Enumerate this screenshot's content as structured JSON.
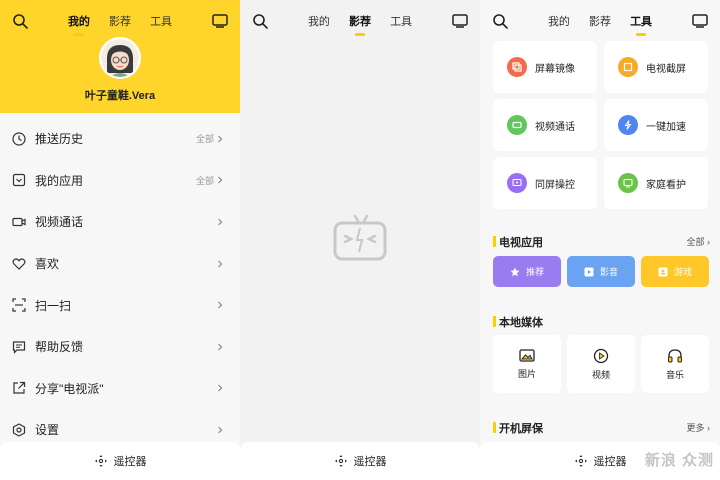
{
  "tabs": [
    "我的",
    "影荐",
    "工具"
  ],
  "panels_active_tab": [
    "我的",
    "影荐",
    "工具"
  ],
  "user": {
    "name": "叶子童鞋.Vera"
  },
  "menu": [
    {
      "label": "推送历史",
      "extra": "全部",
      "icon": "clock-icon"
    },
    {
      "label": "我的应用",
      "extra": "全部",
      "icon": "apps-icon"
    },
    {
      "label": "视频通话",
      "extra": "",
      "icon": "video-icon"
    },
    {
      "label": "喜欢",
      "extra": "",
      "icon": "heart-icon"
    },
    {
      "label": "扫一扫",
      "extra": "",
      "icon": "scan-icon"
    },
    {
      "label": "帮助反馈",
      "extra": "",
      "icon": "feedback-icon"
    },
    {
      "label": "分享\"电视派\"",
      "extra": "",
      "icon": "share-icon"
    },
    {
      "label": "设置",
      "extra": "",
      "icon": "settings-icon"
    }
  ],
  "remote_label": "遥控器",
  "tools": [
    {
      "label": "屏幕镜像",
      "color": "#f26b4c"
    },
    {
      "label": "电视截屏",
      "color": "#f7a928"
    },
    {
      "label": "视频通话",
      "color": "#61c75a"
    },
    {
      "label": "一键加速",
      "color": "#4f86f2"
    },
    {
      "label": "同屏操控",
      "color": "#9a6ef0"
    },
    {
      "label": "家庭看护",
      "color": "#6cc24a"
    }
  ],
  "tv_apps": {
    "title": "电视应用",
    "more": "全部",
    "items": [
      {
        "label": "推荐",
        "color": "#9b7cf0"
      },
      {
        "label": "影音",
        "color": "#6aa3f2"
      },
      {
        "label": "游戏",
        "color": "#ffc72a"
      }
    ]
  },
  "local_media": {
    "title": "本地媒体",
    "items": [
      {
        "label": "图片"
      },
      {
        "label": "视频"
      },
      {
        "label": "音乐"
      }
    ]
  },
  "screensaver": {
    "title": "开机屏保",
    "more": "更多"
  },
  "watermark": "新浪 众测",
  "accent": "#ffd52c"
}
